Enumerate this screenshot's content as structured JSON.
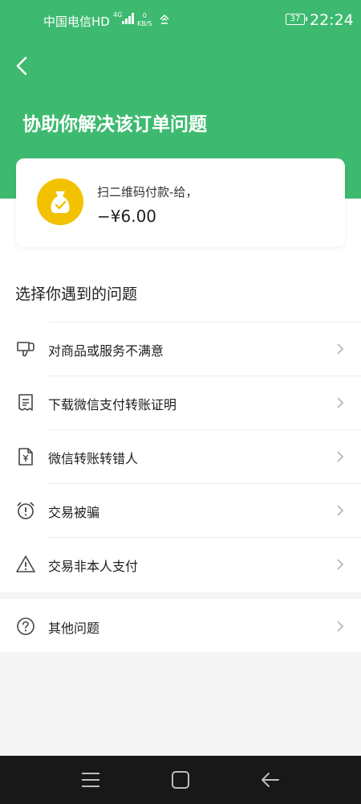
{
  "status_bar": {
    "carrier": "中国电信HD",
    "network": "4G",
    "speed_value": "0",
    "speed_unit": "KB/S",
    "battery": "37",
    "time": "22:24"
  },
  "header": {
    "title": "协助你解决该订单问题"
  },
  "order": {
    "description": "扫二维码付款-给，",
    "amount": "−¥6.00"
  },
  "issues": {
    "section_title": "选择你遇到的问题",
    "items": [
      {
        "label": "对商品或服务不满意",
        "icon": "thumbs-down-icon"
      },
      {
        "label": "下载微信支付转账证明",
        "icon": "receipt-icon"
      },
      {
        "label": "微信转账转错人",
        "icon": "yuan-document-icon"
      },
      {
        "label": "交易被骗",
        "icon": "alarm-alert-icon"
      },
      {
        "label": "交易非本人支付",
        "icon": "warning-triangle-icon"
      }
    ],
    "other": {
      "label": "其他问题",
      "icon": "question-circle-icon"
    }
  },
  "colors": {
    "brand_green": "#3dba6f",
    "coin_yellow": "#f2c200",
    "nav_bar": "#181818"
  }
}
